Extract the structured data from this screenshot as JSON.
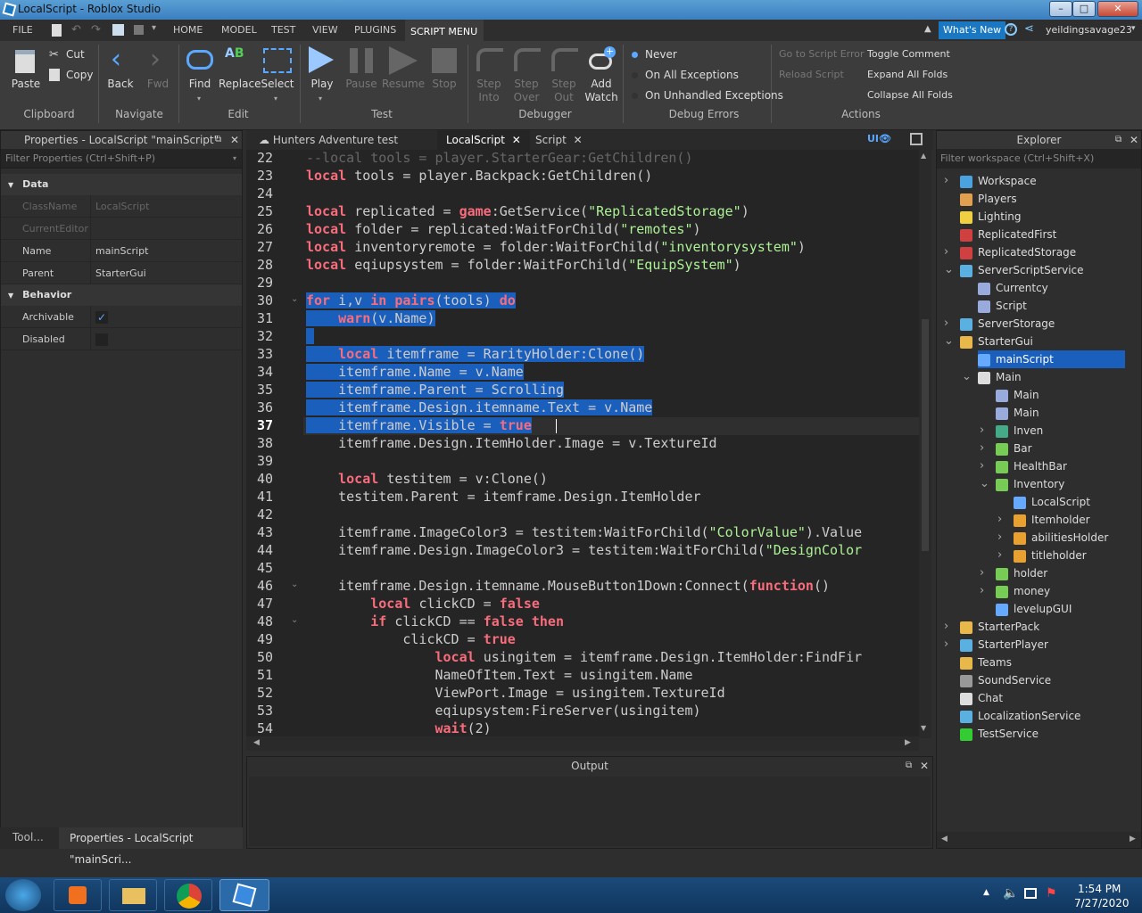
{
  "window": {
    "title": "LocalScript - Roblox Studio",
    "min": "–",
    "max": "□",
    "close": "✕"
  },
  "menu": {
    "tabs": [
      "FILE",
      "HOME",
      "MODEL",
      "TEST",
      "VIEW",
      "PLUGINS",
      "SCRIPT MENU"
    ],
    "whats_new": "What's New",
    "user": "yeildingsavage23"
  },
  "ribbon": {
    "clipboard": {
      "paste": "Paste",
      "cut": "Cut",
      "copy": "Copy",
      "label": "Clipboard"
    },
    "navigate": {
      "back": "Back",
      "fwd": "Fwd",
      "label": "Navigate"
    },
    "edit": {
      "find": "Find",
      "replace": "Replace",
      "select": "Select",
      "label": "Edit"
    },
    "test": {
      "play": "Play",
      "pause": "Pause",
      "resume": "Resume",
      "stop": "Stop",
      "label": "Test"
    },
    "debugger": {
      "step_into": "Step\nInto",
      "step_over": "Step\nOver",
      "step_out": "Step\nOut",
      "add_watch": "Add\nWatch",
      "label": "Debugger"
    },
    "debug_errors": {
      "never": "Never",
      "all": "On All Exceptions",
      "unhandled": "On Unhandled Exceptions",
      "label": "Debug Errors"
    },
    "actions": {
      "go_error": "Go to Script Error",
      "reload": "Reload Script",
      "toggle": "Toggle Comment",
      "expand": "Expand All Folds",
      "collapse": "Collapse All Folds",
      "label": "Actions"
    }
  },
  "properties": {
    "title": "Properties - LocalScript \"mainScript\"",
    "filter": "Filter Properties (Ctrl+Shift+P)",
    "cat_data": "Data",
    "cat_behavior": "Behavior",
    "classname_k": "ClassName",
    "classname_v": "LocalScript",
    "editor_k": "CurrentEditor",
    "name_k": "Name",
    "name_v": "mainScript",
    "parent_k": "Parent",
    "parent_v": "StarterGui",
    "archivable_k": "Archivable",
    "disabled_k": "Disabled"
  },
  "bottom_tabs": {
    "tool": "Tool...",
    "props": "Properties - LocalScript \"mainScri..."
  },
  "editor_tabs": {
    "t1": "Hunters Adventure test server",
    "t2": "LocalScript",
    "t3": "Script"
  },
  "code": {
    "start": 22,
    "current": 37,
    "lines": [
      [
        [
          "cmt",
          "--local tools = player.StarterGear:GetChildren()"
        ]
      ],
      [
        [
          "kw",
          "local"
        ],
        [
          "",
          "tools = player.Backpack:GetChildren()"
        ]
      ],
      [],
      [
        [
          "kw",
          "local"
        ],
        [
          "",
          "replicated = "
        ],
        [
          "kw",
          "game"
        ],
        [
          "",
          ":GetService("
        ],
        [
          "str",
          "\"ReplicatedStorage\""
        ],
        [
          "",
          ")"
        ]
      ],
      [
        [
          "kw",
          "local"
        ],
        [
          "",
          "folder = replicated:WaitForChild("
        ],
        [
          "str",
          "\"remotes\""
        ],
        [
          "",
          ")"
        ]
      ],
      [
        [
          "kw",
          "local"
        ],
        [
          "",
          "inventoryremote = folder:WaitForChild("
        ],
        [
          "str",
          "\"inventorysystem\""
        ],
        [
          "",
          ")"
        ]
      ],
      [
        [
          "kw",
          "local"
        ],
        [
          "",
          "eqiupsystem = folder:WaitForChild("
        ],
        [
          "str",
          "\"EquipSystem\""
        ],
        [
          "",
          ")"
        ]
      ],
      [],
      [
        [
          "kw",
          "for"
        ],
        [
          "",
          "i,v "
        ],
        [
          "kw",
          "in"
        ],
        [
          "",
          ""
        ],
        [
          "kw",
          "pairs"
        ],
        [
          "",
          "(tools) "
        ],
        [
          "kw",
          "do"
        ]
      ],
      [
        [
          "",
          "    "
        ],
        [
          "kw",
          "warn"
        ],
        [
          "",
          "(v.Name)"
        ]
      ],
      [],
      [
        [
          "",
          "    "
        ],
        [
          "kw",
          "local"
        ],
        [
          "",
          "itemframe = RarityHolder:Clone()"
        ]
      ],
      [
        [
          "",
          "    itemframe.Name = v.Name"
        ]
      ],
      [
        [
          "",
          "    itemframe.Parent = Scrolling"
        ]
      ],
      [
        [
          "",
          "    itemframe.Design.itemname.Text = v.Name"
        ]
      ],
      [
        [
          "",
          "    itemframe.Visible = "
        ],
        [
          "kw",
          "true"
        ]
      ],
      [
        [
          "",
          "    itemframe.Design.ItemHolder.Image = v.TextureId"
        ]
      ],
      [],
      [
        [
          "",
          "    "
        ],
        [
          "kw",
          "local"
        ],
        [
          "",
          "testitem = v:Clone()"
        ]
      ],
      [
        [
          "",
          "    testitem.Parent = itemframe.Design.ItemHolder"
        ]
      ],
      [],
      [
        [
          "",
          "    itemframe.ImageColor3 = testitem:WaitForChild("
        ],
        [
          "str",
          "\"ColorValue\""
        ],
        [
          "",
          ").Value"
        ]
      ],
      [
        [
          "",
          "    itemframe.Design.ImageColor3 = testitem:WaitForChild("
        ],
        [
          "str",
          "\"DesignColor"
        ]
      ],
      [],
      [
        [
          "",
          "    itemframe.Design.itemname.MouseButton1Down:Connect("
        ],
        [
          "kw",
          "function"
        ],
        [
          "",
          "()"
        ]
      ],
      [
        [
          "",
          "        "
        ],
        [
          "kw",
          "local"
        ],
        [
          "",
          "clickCD = "
        ],
        [
          "kw",
          "false"
        ]
      ],
      [
        [
          "",
          "        "
        ],
        [
          "kw",
          "if"
        ],
        [
          "",
          "clickCD == "
        ],
        [
          "kw",
          "false"
        ],
        [
          "",
          ""
        ],
        [
          "kw",
          "then"
        ]
      ],
      [
        [
          "",
          "            clickCD = "
        ],
        [
          "kw",
          "true"
        ]
      ],
      [
        [
          "",
          "                "
        ],
        [
          "kw",
          "local"
        ],
        [
          "",
          "usingitem = itemframe.Design.ItemHolder:FindFir"
        ]
      ],
      [
        [
          "",
          "                NameOfItem.Text = usingitem.Name"
        ]
      ],
      [
        [
          "",
          "                ViewPort.Image = usingitem.TextureId"
        ]
      ],
      [
        [
          "",
          "                eqiupsystem:FireServer(usingitem)"
        ]
      ],
      [
        [
          "",
          "                "
        ],
        [
          "kw",
          "wait"
        ],
        [
          "",
          "(2)"
        ]
      ]
    ]
  },
  "output": {
    "title": "Output"
  },
  "explorer": {
    "title": "Explorer",
    "filter": "Filter workspace (Ctrl+Shift+X)",
    "items": [
      {
        "label": "Workspace",
        "depth": 0,
        "arrow": "›",
        "icon": "#4aa3df"
      },
      {
        "label": "Players",
        "depth": 0,
        "arrow": "",
        "icon": "#e0a050"
      },
      {
        "label": "Lighting",
        "depth": 0,
        "arrow": "",
        "icon": "#f0d040"
      },
      {
        "label": "ReplicatedFirst",
        "depth": 0,
        "arrow": "",
        "icon": "#d04040"
      },
      {
        "label": "ReplicatedStorage",
        "depth": 0,
        "arrow": "›",
        "icon": "#d04040"
      },
      {
        "label": "ServerScriptService",
        "depth": 0,
        "arrow": "⌄",
        "icon": "#5ab0e0"
      },
      {
        "label": "Currentcy",
        "depth": 1,
        "arrow": "",
        "icon": "#9ad"
      },
      {
        "label": "Script",
        "depth": 1,
        "arrow": "",
        "icon": "#9ad"
      },
      {
        "label": "ServerStorage",
        "depth": 0,
        "arrow": "›",
        "icon": "#5ab0e0"
      },
      {
        "label": "StarterGui",
        "depth": 0,
        "arrow": "⌄",
        "icon": "#e8b84a"
      },
      {
        "label": "mainScript",
        "depth": 1,
        "arrow": "",
        "icon": "#6af",
        "selected": true
      },
      {
        "label": "Main",
        "depth": 1,
        "arrow": "⌄",
        "icon": "#ddd"
      },
      {
        "label": "Main",
        "depth": 2,
        "arrow": "",
        "icon": "#9ad"
      },
      {
        "label": "Main",
        "depth": 2,
        "arrow": "",
        "icon": "#9ad"
      },
      {
        "label": "Inven",
        "depth": 2,
        "arrow": "›",
        "icon": "#4a8"
      },
      {
        "label": "Bar",
        "depth": 2,
        "arrow": "›",
        "icon": "#7c5"
      },
      {
        "label": "HealthBar",
        "depth": 2,
        "arrow": "›",
        "icon": "#7c5"
      },
      {
        "label": "Inventory",
        "depth": 2,
        "arrow": "⌄",
        "icon": "#7c5"
      },
      {
        "label": "LocalScript",
        "depth": 3,
        "arrow": "",
        "icon": "#6af"
      },
      {
        "label": "Itemholder",
        "depth": 3,
        "arrow": "›",
        "icon": "#e8a030"
      },
      {
        "label": "abilitiesHolder",
        "depth": 3,
        "arrow": "›",
        "icon": "#e8a030"
      },
      {
        "label": "titleholder",
        "depth": 3,
        "arrow": "›",
        "icon": "#e8a030"
      },
      {
        "label": "holder",
        "depth": 2,
        "arrow": "›",
        "icon": "#7c5"
      },
      {
        "label": "money",
        "depth": 2,
        "arrow": "›",
        "icon": "#7c5"
      },
      {
        "label": "levelupGUI",
        "depth": 2,
        "arrow": "",
        "icon": "#6af"
      },
      {
        "label": "StarterPack",
        "depth": 0,
        "arrow": "›",
        "icon": "#e8b84a"
      },
      {
        "label": "StarterPlayer",
        "depth": 0,
        "arrow": "›",
        "icon": "#5ab0e0"
      },
      {
        "label": "Teams",
        "depth": 0,
        "arrow": "",
        "icon": "#e8b84a"
      },
      {
        "label": "SoundService",
        "depth": 0,
        "arrow": "",
        "icon": "#999"
      },
      {
        "label": "Chat",
        "depth": 0,
        "arrow": "",
        "icon": "#ddd"
      },
      {
        "label": "LocalizationService",
        "depth": 0,
        "arrow": "",
        "icon": "#5ab0e0"
      },
      {
        "label": "TestService",
        "depth": 0,
        "arrow": "",
        "icon": "#3c3"
      }
    ]
  },
  "taskbar": {
    "time": "1:54 PM",
    "date": "7/27/2020"
  }
}
